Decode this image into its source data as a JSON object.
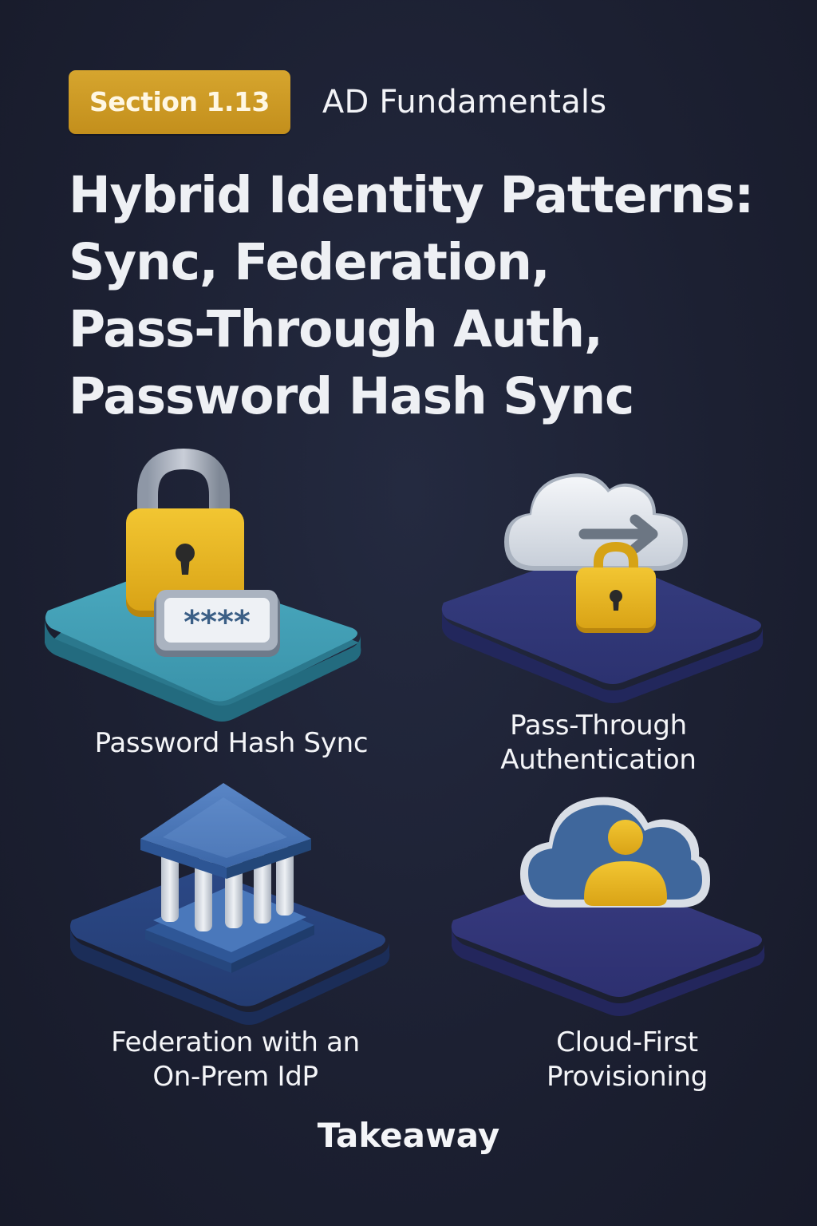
{
  "header": {
    "badge": "Section 1.13",
    "category": "AD Fundamentals"
  },
  "title_lines": [
    "Hybrid Identity Patterns:",
    "Sync, Federation,",
    "Pass-Through Auth,",
    "Password Hash Sync"
  ],
  "tiles": [
    {
      "icon": "padlock-password-icon",
      "label_lines": [
        "Password Hash Sync"
      ],
      "color": "#3a93aa",
      "masked_text": "****"
    },
    {
      "icon": "cloud-arrow-lock-icon",
      "label_lines": [
        "Pass-Through",
        "Authentication"
      ],
      "color": "#2e3470"
    },
    {
      "icon": "building-columns-icon",
      "label_lines": [
        "Federation with an",
        "On-Prem IdP"
      ],
      "color": "#263f78"
    },
    {
      "icon": "cloud-user-icon",
      "label_lines": [
        "Cloud-First",
        "Provisioning"
      ],
      "color": "#2f3270"
    }
  ],
  "footer": {
    "takeaway": "Takeaway"
  },
  "colors": {
    "background": "#1c2032",
    "badge": "#c9971f",
    "lock_gold": "#e6b420"
  }
}
